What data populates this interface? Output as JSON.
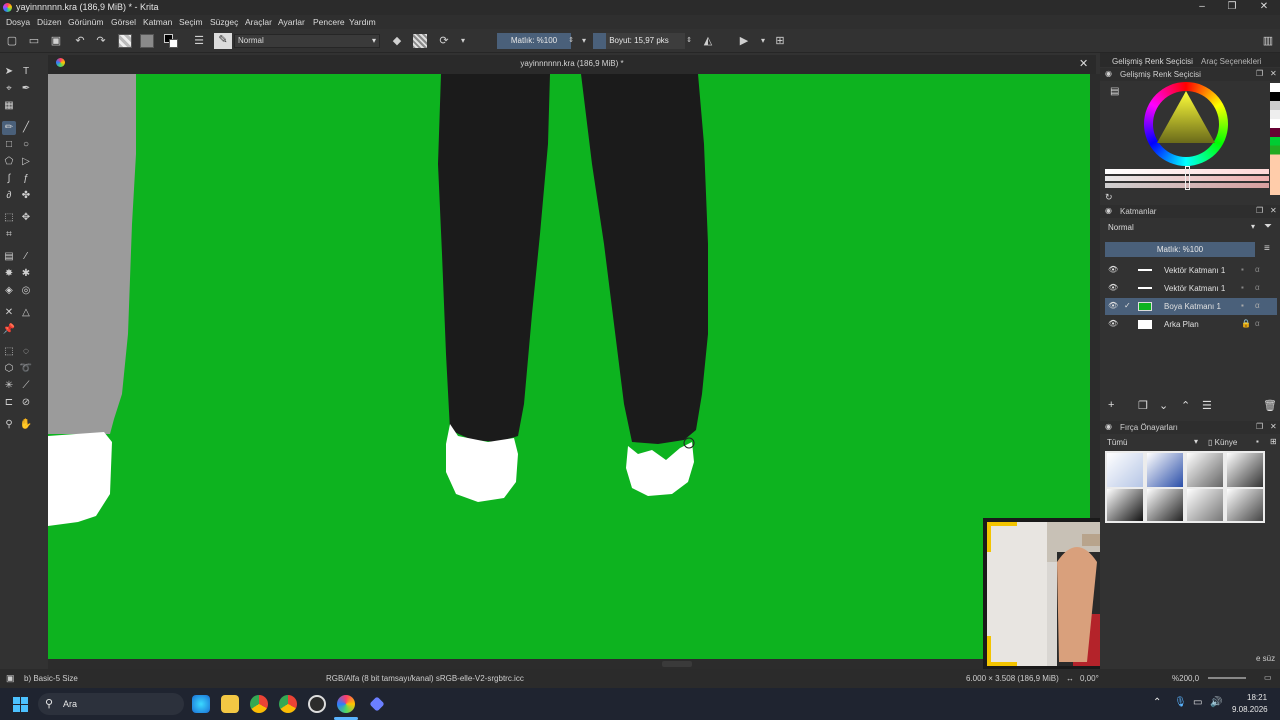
{
  "window": {
    "title": "yayinnnnnn.kra (186,9 MiB) * - Krita",
    "controls": [
      "–",
      "❐",
      "✕"
    ]
  },
  "menu": [
    "Dosya",
    "Düzen",
    "Görünüm",
    "Görsel",
    "Katman",
    "Seçim",
    "Süzgeç",
    "Araçlar",
    "Ayarlar",
    "Pencere",
    "Yardım"
  ],
  "toolbar": {
    "blend_mode": "Normal",
    "opacity_label": "Matlık: %100",
    "size_label": "Boyut: 15,97 pks"
  },
  "document": {
    "tab_title": "yayinnnnnn.kra (186,9 MiB) *",
    "close": "✕"
  },
  "docker": {
    "tabs": [
      "Gelişmiş Renk Seçicisi",
      "Araç Seçenekleri"
    ],
    "color_selector_title": "Gelişmiş Renk Seçicisi",
    "layers_title": "Katmanlar",
    "layers_blend": "Normal",
    "layers_opacity": "Matlık: %100",
    "layers": [
      {
        "name": "Vektör Katmanı 1",
        "selected": false
      },
      {
        "name": "Vektör Katmanı 1",
        "selected": false
      },
      {
        "name": "Boya Katmanı 1",
        "selected": true
      },
      {
        "name": "Arka Plan",
        "selected": false
      }
    ],
    "brush_presets_title": "Fırça Önayarları",
    "brush_filter": "Tümü",
    "brush_tag": "Künye",
    "brush_search_hint": "e süz"
  },
  "status": {
    "brush": "b) Basic-5 Size",
    "color_profile": "RGB/Alfa (8 bit tamsayı/kanal) sRGB-elle-V2-srgbtrc.icc",
    "dimensions": "6.000 × 3.508 (186,9 MiB)",
    "rotation": "0,00°",
    "zoom": "%200,0"
  },
  "taskbar": {
    "search_placeholder": "Ara",
    "time": "18:21",
    "date": "9.08.2026"
  },
  "colors": {
    "canvas_green": "#0db31f",
    "accent": "#4a607a"
  }
}
